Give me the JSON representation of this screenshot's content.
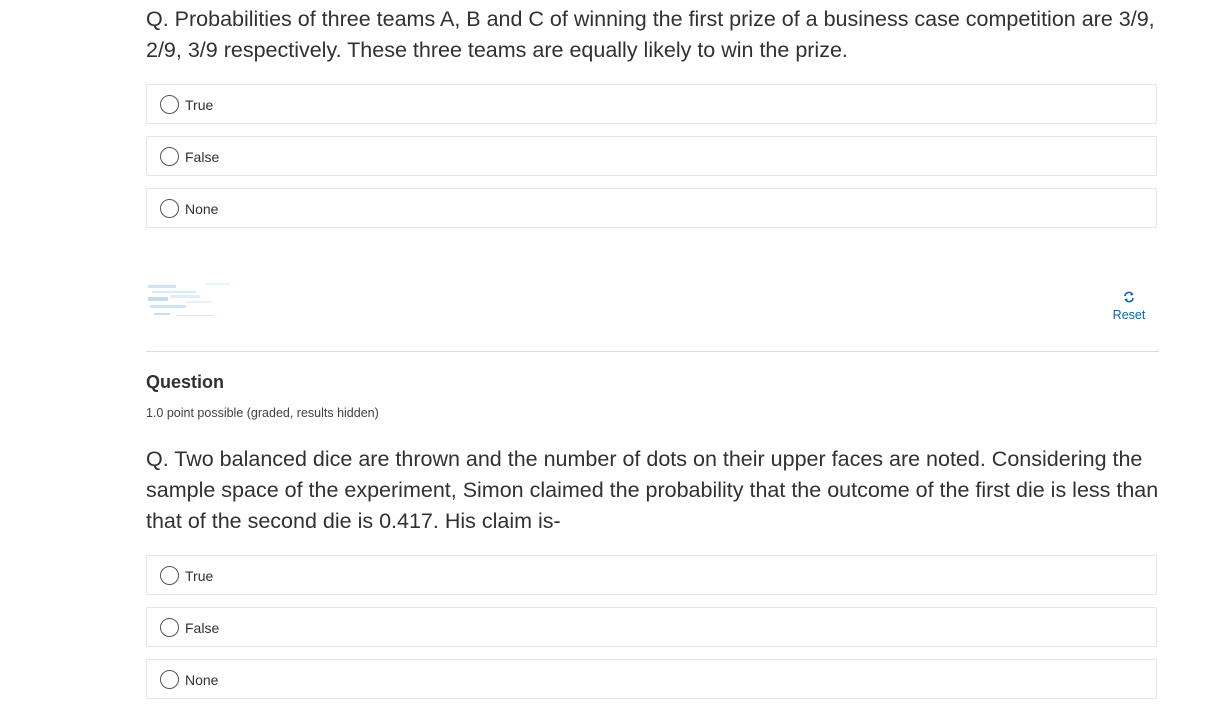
{
  "problem1": {
    "question_text": "Q. Probabilities of three teams A, B and C of winning the first prize of a business case competition are 3/9, 2/9, 3/9 respectively. These three teams are equally likely to win the prize.",
    "options": [
      {
        "label": "True"
      },
      {
        "label": "False"
      },
      {
        "label": "None"
      }
    ]
  },
  "actions": {
    "reset_label": "Reset",
    "reset_icon": "refresh-icon",
    "link_color": "#0a64b0"
  },
  "problem2": {
    "heading": "Question",
    "points": "1.0 point possible (graded, results hidden)",
    "question_text": "Q. Two balanced dice are thrown and the number of dots on their upper faces are noted. Considering the sample space of the experiment, Simon claimed the probability that the outcome of the first die is less than that of the second die is 0.417. His claim is-",
    "options": [
      {
        "label": "True"
      },
      {
        "label": "False"
      },
      {
        "label": "None"
      }
    ]
  }
}
